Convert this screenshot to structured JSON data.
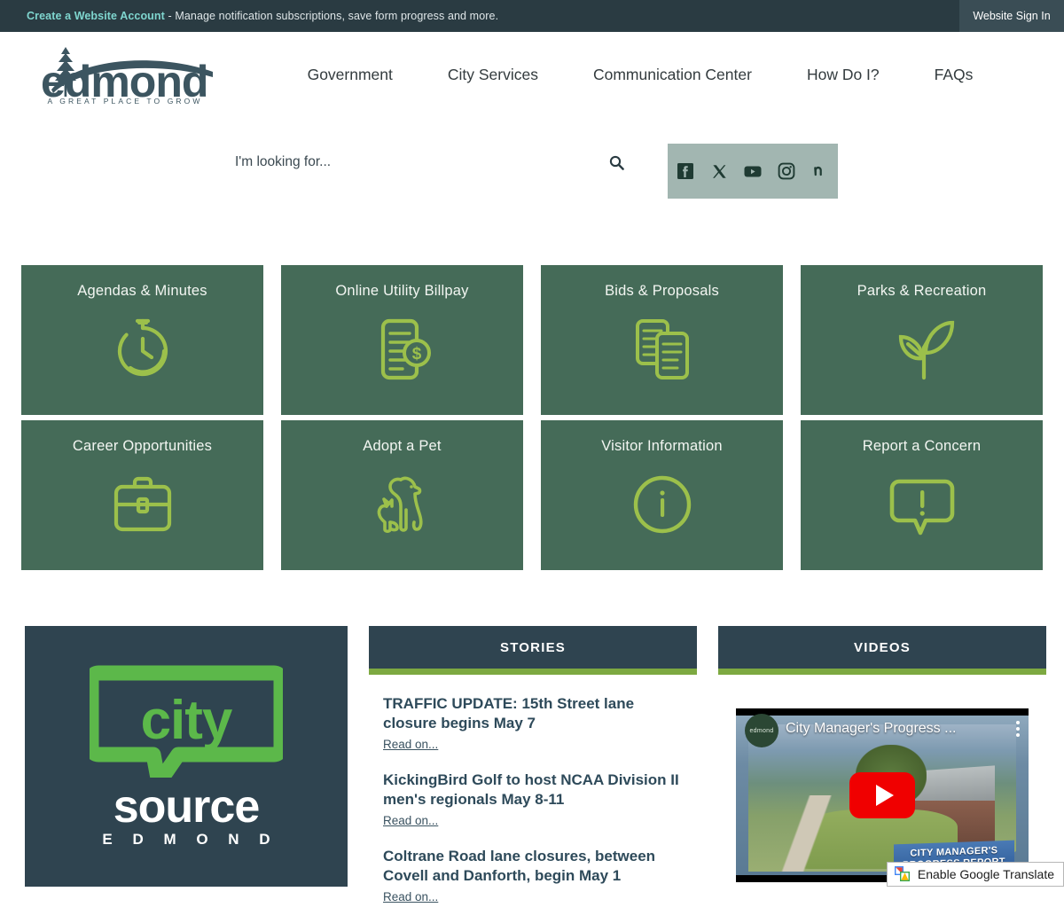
{
  "topbar": {
    "account_link": "Create a Website Account",
    "message": " - Manage notification subscriptions, save form progress and more.",
    "signin_label": "Website Sign In"
  },
  "brand": {
    "name": "edmond",
    "tagline": "A GREAT PLACE TO GROW"
  },
  "nav": {
    "items": [
      {
        "label": "Government"
      },
      {
        "label": "City Services"
      },
      {
        "label": "Communication Center"
      },
      {
        "label": "How Do I?"
      },
      {
        "label": "FAQs"
      }
    ]
  },
  "search": {
    "placeholder": "I'm looking for...",
    "value": ""
  },
  "social": {
    "items": [
      {
        "name": "facebook-icon"
      },
      {
        "name": "x-twitter-icon"
      },
      {
        "name": "youtube-icon"
      },
      {
        "name": "instagram-icon"
      },
      {
        "name": "nextdoor-icon"
      }
    ]
  },
  "tiles": [
    {
      "label": "Agendas & Minutes",
      "icon": "stopwatch-icon"
    },
    {
      "label": "Online Utility Billpay",
      "icon": "bill-dollar-icon"
    },
    {
      "label": "Bids & Proposals",
      "icon": "documents-icon"
    },
    {
      "label": "Parks & Recreation",
      "icon": "leaf-sprout-icon"
    },
    {
      "label": "Career Opportunities",
      "icon": "briefcase-icon"
    },
    {
      "label": "Adopt a Pet",
      "icon": "dog-cat-icon"
    },
    {
      "label": "Visitor Information",
      "icon": "info-circle-icon"
    },
    {
      "label": "Report a Concern",
      "icon": "speech-bubble-alert-icon"
    }
  ],
  "citysource": {
    "word_city": "city",
    "word_source": "source",
    "word_edmond": "E D M O N D"
  },
  "stories": {
    "heading": "STORIES",
    "items": [
      {
        "title": "TRAFFIC UPDATE: 15th Street lane closure begins May 7",
        "readon": "Read on..."
      },
      {
        "title": "KickingBird Golf to host NCAA Division II men's regionals May 8-11",
        "readon": "Read on..."
      },
      {
        "title": "Coltrane Road lane closures, between Covell and Danforth, begin May 1",
        "readon": "Read on..."
      }
    ]
  },
  "videos": {
    "heading": "VIDEOS",
    "video_title": "City Manager's Progress ...",
    "channel_badge": "edmond",
    "overlay_line1": "CITY MANAGER'S",
    "overlay_line2": "PROGRESS REPORT"
  },
  "translate": {
    "label": "Enable Google Translate"
  },
  "colors": {
    "topbar_bg": "#2a3b42",
    "account_link": "#7fd6cf",
    "tile_bg": "#456b58",
    "tile_icon": "#9cc04b",
    "panel_head_bg": "#2f4450",
    "panel_accent": "#7da941",
    "social_bar_bg": "#a2b6b1",
    "citysource_bg": "#2f4450",
    "citysource_green": "#5cb84a",
    "story_title": "#2e4a5a",
    "play_red": "#f00000"
  }
}
